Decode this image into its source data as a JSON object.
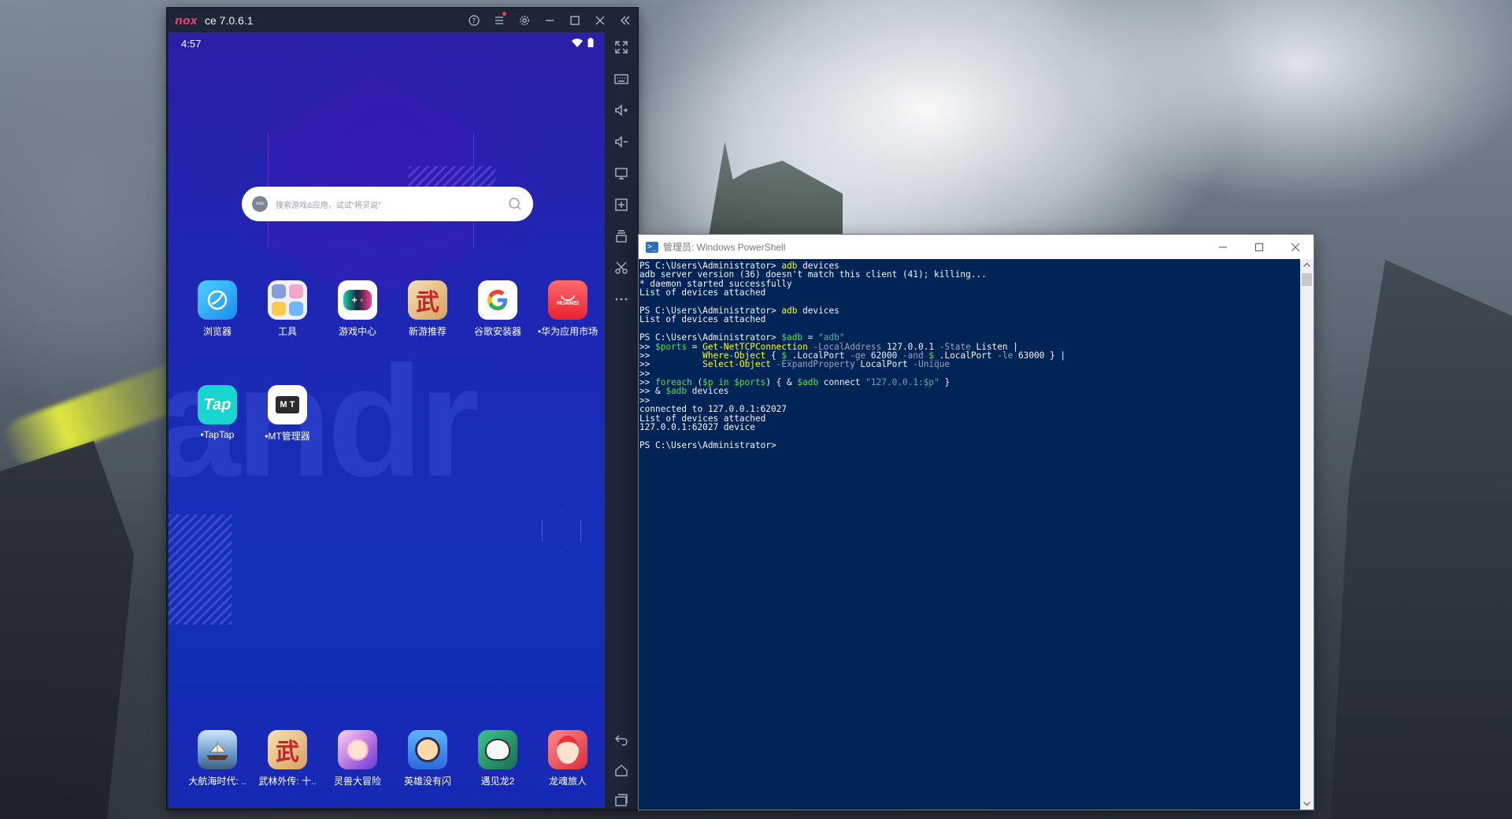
{
  "nox": {
    "version": "ce 7.0.6.1",
    "logo_text": "nox",
    "title_icons": [
      "help-icon",
      "menu-icon",
      "settings-icon",
      "minimize-icon",
      "maximize-icon",
      "close-icon",
      "collapse-icon"
    ],
    "status": {
      "time": "4:57"
    },
    "search": {
      "placeholder": "搜索游戏&应用，试试“将灵说”"
    },
    "apps_row1": [
      "浏览器",
      "工具",
      "游戏中心",
      "新游推荐",
      "谷歌安装器",
      "•华为应用市场"
    ],
    "apps_row2": [
      "•TapTap",
      "•MT管理器"
    ],
    "dock_apps": [
      "大航海时代: ..",
      "武林外传: 十..",
      "灵兽大冒险",
      "英雄没有闪",
      "遇见龙2",
      "龙魂旅人"
    ],
    "huawei_badge": "HUAWEI",
    "tap_badge": "Tap",
    "mt_badge": "M T",
    "sidebar_tools": [
      "fullscreen-icon",
      "keyboard-icon",
      "volume-up-icon",
      "volume-down-icon",
      "screen-icon",
      "apk-install-icon",
      "multi-instance-icon",
      "scissors-icon",
      "more-icon",
      "back-icon",
      "home-icon",
      "recent-apps-icon"
    ]
  },
  "powershell": {
    "title": "管理员: Windows PowerShell",
    "lines": [
      [
        {
          "t": "PS C:\\Users\\Administrator> ",
          "c": "w"
        },
        {
          "t": "adb",
          "c": "y"
        },
        {
          "t": " devices",
          "c": "w"
        }
      ],
      [
        {
          "t": "adb server version (36) doesn't match this client (41); killing...",
          "c": "w"
        }
      ],
      [
        {
          "t": "* daemon started successfully",
          "c": "w"
        }
      ],
      [
        {
          "t": "List of devices attached",
          "c": "w"
        }
      ],
      [
        {
          "t": "",
          "c": "w"
        }
      ],
      [
        {
          "t": "PS C:\\Users\\Administrator> ",
          "c": "w"
        },
        {
          "t": "adb",
          "c": "y"
        },
        {
          "t": " devices",
          "c": "w"
        }
      ],
      [
        {
          "t": "List of devices attached",
          "c": "w"
        }
      ],
      [
        {
          "t": "",
          "c": "w"
        }
      ],
      [
        {
          "t": "PS C:\\Users\\Administrator> ",
          "c": "w"
        },
        {
          "t": "$adb",
          "c": "g"
        },
        {
          "t": " = ",
          "c": "w"
        },
        {
          "t": "\"adb\"",
          "c": "s"
        }
      ],
      [
        {
          "t": ">> ",
          "c": "w"
        },
        {
          "t": "$ports",
          "c": "g"
        },
        {
          "t": " = ",
          "c": "w"
        },
        {
          "t": "Get-NetTCPConnection",
          "c": "y"
        },
        {
          "t": " -LocalAddress",
          "c": "gr"
        },
        {
          "t": " 127.0.0.1",
          "c": "w"
        },
        {
          "t": " -State",
          "c": "gr"
        },
        {
          "t": " Listen |",
          "c": "w"
        }
      ],
      [
        {
          "t": ">>          ",
          "c": "w"
        },
        {
          "t": "Where-Object",
          "c": "y"
        },
        {
          "t": " { ",
          "c": "w"
        },
        {
          "t": "$_",
          "c": "g"
        },
        {
          "t": ".LocalPort",
          "c": "w"
        },
        {
          "t": " -ge",
          "c": "gr"
        },
        {
          "t": " 62000",
          "c": "w"
        },
        {
          "t": " -and",
          "c": "gr"
        },
        {
          "t": " ",
          "c": "w"
        },
        {
          "t": "$_",
          "c": "g"
        },
        {
          "t": ".LocalPort",
          "c": "w"
        },
        {
          "t": " -le",
          "c": "gr"
        },
        {
          "t": " 63000 } |",
          "c": "w"
        }
      ],
      [
        {
          "t": ">>          ",
          "c": "w"
        },
        {
          "t": "Select-Object",
          "c": "y"
        },
        {
          "t": " -ExpandProperty",
          "c": "gr"
        },
        {
          "t": " LocalPort",
          "c": "w"
        },
        {
          "t": " -Unique",
          "c": "gr"
        }
      ],
      [
        {
          "t": ">>",
          "c": "w"
        }
      ],
      [
        {
          "t": ">> ",
          "c": "w"
        },
        {
          "t": "foreach",
          "c": "g"
        },
        {
          "t": " (",
          "c": "w"
        },
        {
          "t": "$p",
          "c": "g"
        },
        {
          "t": " in ",
          "c": "g"
        },
        {
          "t": "$ports",
          "c": "g"
        },
        {
          "t": ") { & ",
          "c": "w"
        },
        {
          "t": "$adb",
          "c": "g"
        },
        {
          "t": " connect ",
          "c": "w"
        },
        {
          "t": "\"127.0.0.1:$p\"",
          "c": "s"
        },
        {
          "t": " }",
          "c": "w"
        }
      ],
      [
        {
          "t": ">> & ",
          "c": "w"
        },
        {
          "t": "$adb",
          "c": "g"
        },
        {
          "t": " devices",
          "c": "w"
        }
      ],
      [
        {
          "t": ">>",
          "c": "w"
        }
      ],
      [
        {
          "t": "connected to 127.0.0.1:62027",
          "c": "w"
        }
      ],
      [
        {
          "t": "List of devices attached",
          "c": "w"
        }
      ],
      [
        {
          "t": "127.0.0.1:62027 device",
          "c": "w"
        }
      ],
      [
        {
          "t": "",
          "c": "w"
        }
      ],
      [
        {
          "t": "PS C:\\Users\\Administrator> ",
          "c": "w"
        }
      ]
    ]
  },
  "colors": {
    "ps_background": "#012456",
    "nox_frame": "#1e2536",
    "android_blue": "#1d27b4"
  }
}
